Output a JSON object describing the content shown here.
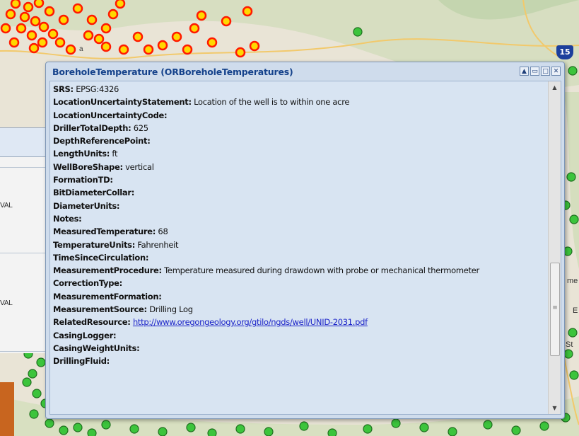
{
  "popup": {
    "title": "BoreholeTemperature (ORBoreholeTemperatures)",
    "buttons": [
      "▲",
      "▭",
      "□",
      "✕"
    ],
    "rows": [
      {
        "key": "SRS",
        "value": " EPSG:4326"
      },
      {
        "key": "LocationUncertaintyStatement",
        "value": " Location of the well is to within one acre"
      },
      {
        "key": "LocationUncertaintyCode",
        "value": ""
      },
      {
        "key": "DrillerTotalDepth",
        "value": " 625"
      },
      {
        "key": "DepthReferencePoint",
        "value": ""
      },
      {
        "key": "LengthUnits",
        "value": " ft"
      },
      {
        "key": "WellBoreShape",
        "value": " vertical"
      },
      {
        "key": "FormationTD",
        "value": ""
      },
      {
        "key": "BitDiameterCollar",
        "value": ""
      },
      {
        "key": "DiameterUnits",
        "value": ""
      },
      {
        "key": "Notes",
        "value": ""
      },
      {
        "key": "MeasuredTemperature",
        "value": " 68"
      },
      {
        "key": "TemperatureUnits",
        "value": " Fahrenheit"
      },
      {
        "key": "TimeSinceCirculation",
        "value": ""
      },
      {
        "key": "MeasurementProcedure",
        "value": " Temperature measured during drawdown with probe or mechanical thermometer",
        "wrap": true
      },
      {
        "key": "CorrectionType",
        "value": ""
      },
      {
        "key": "MeasurementFormation",
        "value": ""
      },
      {
        "key": "MeasurementSource",
        "value": " Drilling Log"
      },
      {
        "key": "RelatedResource",
        "value": "",
        "link": "http://www.oregongeology.org/gtilo/ngds/well/UNID-2031.pdf"
      },
      {
        "key": "CasingLogger",
        "value": ""
      },
      {
        "key": "CasingWeightUnits",
        "value": ""
      },
      {
        "key": "DrillingFluid",
        "value": ""
      }
    ]
  },
  "left_panel": {
    "label_1": "VAL",
    "label_2": "VAL"
  },
  "map": {
    "highway_shield": "15",
    "town_label": "a",
    "right_labels": [
      "me",
      "E",
      "St"
    ],
    "colors": {
      "red_marker": "#ff1a00",
      "yellow_marker": "#ffd800",
      "green_marker": "#3cc43c",
      "map_bg": "#e9e4d6"
    }
  }
}
